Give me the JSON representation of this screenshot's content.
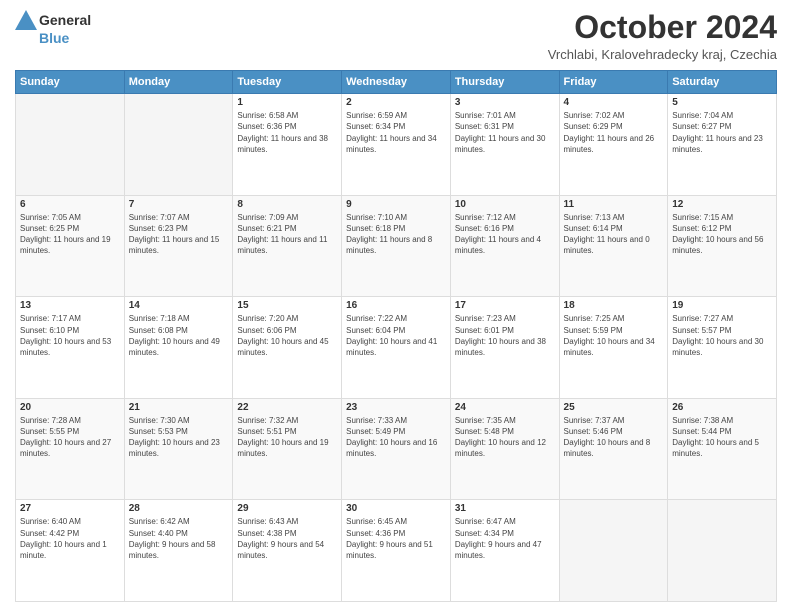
{
  "logo": {
    "general": "General",
    "blue": "Blue"
  },
  "title": "October 2024",
  "location": "Vrchlabi, Kralovehradecky kraj, Czechia",
  "days_of_week": [
    "Sunday",
    "Monday",
    "Tuesday",
    "Wednesday",
    "Thursday",
    "Friday",
    "Saturday"
  ],
  "weeks": [
    [
      {
        "day": "",
        "sunrise": "",
        "sunset": "",
        "daylight": ""
      },
      {
        "day": "",
        "sunrise": "",
        "sunset": "",
        "daylight": ""
      },
      {
        "day": "1",
        "sunrise": "Sunrise: 6:58 AM",
        "sunset": "Sunset: 6:36 PM",
        "daylight": "Daylight: 11 hours and 38 minutes."
      },
      {
        "day": "2",
        "sunrise": "Sunrise: 6:59 AM",
        "sunset": "Sunset: 6:34 PM",
        "daylight": "Daylight: 11 hours and 34 minutes."
      },
      {
        "day": "3",
        "sunrise": "Sunrise: 7:01 AM",
        "sunset": "Sunset: 6:31 PM",
        "daylight": "Daylight: 11 hours and 30 minutes."
      },
      {
        "day": "4",
        "sunrise": "Sunrise: 7:02 AM",
        "sunset": "Sunset: 6:29 PM",
        "daylight": "Daylight: 11 hours and 26 minutes."
      },
      {
        "day": "5",
        "sunrise": "Sunrise: 7:04 AM",
        "sunset": "Sunset: 6:27 PM",
        "daylight": "Daylight: 11 hours and 23 minutes."
      }
    ],
    [
      {
        "day": "6",
        "sunrise": "Sunrise: 7:05 AM",
        "sunset": "Sunset: 6:25 PM",
        "daylight": "Daylight: 11 hours and 19 minutes."
      },
      {
        "day": "7",
        "sunrise": "Sunrise: 7:07 AM",
        "sunset": "Sunset: 6:23 PM",
        "daylight": "Daylight: 11 hours and 15 minutes."
      },
      {
        "day": "8",
        "sunrise": "Sunrise: 7:09 AM",
        "sunset": "Sunset: 6:21 PM",
        "daylight": "Daylight: 11 hours and 11 minutes."
      },
      {
        "day": "9",
        "sunrise": "Sunrise: 7:10 AM",
        "sunset": "Sunset: 6:18 PM",
        "daylight": "Daylight: 11 hours and 8 minutes."
      },
      {
        "day": "10",
        "sunrise": "Sunrise: 7:12 AM",
        "sunset": "Sunset: 6:16 PM",
        "daylight": "Daylight: 11 hours and 4 minutes."
      },
      {
        "day": "11",
        "sunrise": "Sunrise: 7:13 AM",
        "sunset": "Sunset: 6:14 PM",
        "daylight": "Daylight: 11 hours and 0 minutes."
      },
      {
        "day": "12",
        "sunrise": "Sunrise: 7:15 AM",
        "sunset": "Sunset: 6:12 PM",
        "daylight": "Daylight: 10 hours and 56 minutes."
      }
    ],
    [
      {
        "day": "13",
        "sunrise": "Sunrise: 7:17 AM",
        "sunset": "Sunset: 6:10 PM",
        "daylight": "Daylight: 10 hours and 53 minutes."
      },
      {
        "day": "14",
        "sunrise": "Sunrise: 7:18 AM",
        "sunset": "Sunset: 6:08 PM",
        "daylight": "Daylight: 10 hours and 49 minutes."
      },
      {
        "day": "15",
        "sunrise": "Sunrise: 7:20 AM",
        "sunset": "Sunset: 6:06 PM",
        "daylight": "Daylight: 10 hours and 45 minutes."
      },
      {
        "day": "16",
        "sunrise": "Sunrise: 7:22 AM",
        "sunset": "Sunset: 6:04 PM",
        "daylight": "Daylight: 10 hours and 41 minutes."
      },
      {
        "day": "17",
        "sunrise": "Sunrise: 7:23 AM",
        "sunset": "Sunset: 6:01 PM",
        "daylight": "Daylight: 10 hours and 38 minutes."
      },
      {
        "day": "18",
        "sunrise": "Sunrise: 7:25 AM",
        "sunset": "Sunset: 5:59 PM",
        "daylight": "Daylight: 10 hours and 34 minutes."
      },
      {
        "day": "19",
        "sunrise": "Sunrise: 7:27 AM",
        "sunset": "Sunset: 5:57 PM",
        "daylight": "Daylight: 10 hours and 30 minutes."
      }
    ],
    [
      {
        "day": "20",
        "sunrise": "Sunrise: 7:28 AM",
        "sunset": "Sunset: 5:55 PM",
        "daylight": "Daylight: 10 hours and 27 minutes."
      },
      {
        "day": "21",
        "sunrise": "Sunrise: 7:30 AM",
        "sunset": "Sunset: 5:53 PM",
        "daylight": "Daylight: 10 hours and 23 minutes."
      },
      {
        "day": "22",
        "sunrise": "Sunrise: 7:32 AM",
        "sunset": "Sunset: 5:51 PM",
        "daylight": "Daylight: 10 hours and 19 minutes."
      },
      {
        "day": "23",
        "sunrise": "Sunrise: 7:33 AM",
        "sunset": "Sunset: 5:49 PM",
        "daylight": "Daylight: 10 hours and 16 minutes."
      },
      {
        "day": "24",
        "sunrise": "Sunrise: 7:35 AM",
        "sunset": "Sunset: 5:48 PM",
        "daylight": "Daylight: 10 hours and 12 minutes."
      },
      {
        "day": "25",
        "sunrise": "Sunrise: 7:37 AM",
        "sunset": "Sunset: 5:46 PM",
        "daylight": "Daylight: 10 hours and 8 minutes."
      },
      {
        "day": "26",
        "sunrise": "Sunrise: 7:38 AM",
        "sunset": "Sunset: 5:44 PM",
        "daylight": "Daylight: 10 hours and 5 minutes."
      }
    ],
    [
      {
        "day": "27",
        "sunrise": "Sunrise: 6:40 AM",
        "sunset": "Sunset: 4:42 PM",
        "daylight": "Daylight: 10 hours and 1 minute."
      },
      {
        "day": "28",
        "sunrise": "Sunrise: 6:42 AM",
        "sunset": "Sunset: 4:40 PM",
        "daylight": "Daylight: 9 hours and 58 minutes."
      },
      {
        "day": "29",
        "sunrise": "Sunrise: 6:43 AM",
        "sunset": "Sunset: 4:38 PM",
        "daylight": "Daylight: 9 hours and 54 minutes."
      },
      {
        "day": "30",
        "sunrise": "Sunrise: 6:45 AM",
        "sunset": "Sunset: 4:36 PM",
        "daylight": "Daylight: 9 hours and 51 minutes."
      },
      {
        "day": "31",
        "sunrise": "Sunrise: 6:47 AM",
        "sunset": "Sunset: 4:34 PM",
        "daylight": "Daylight: 9 hours and 47 minutes."
      },
      {
        "day": "",
        "sunrise": "",
        "sunset": "",
        "daylight": ""
      },
      {
        "day": "",
        "sunrise": "",
        "sunset": "",
        "daylight": ""
      }
    ]
  ]
}
